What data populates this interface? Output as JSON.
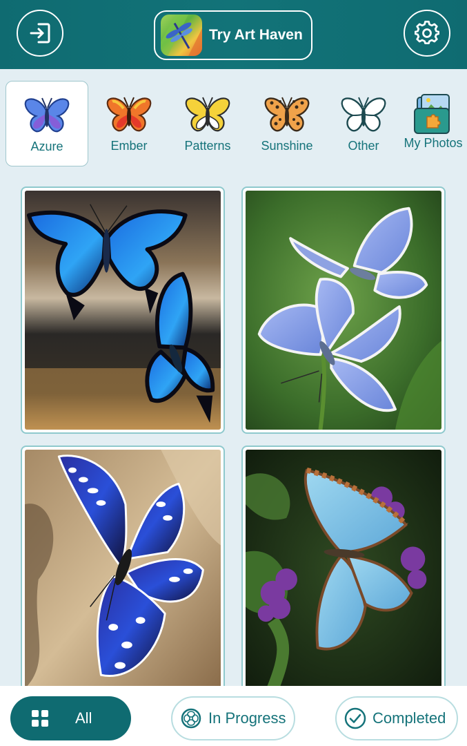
{
  "header": {
    "login_icon": "login-icon",
    "settings_icon": "gear-icon",
    "promo_label": "Try Art Haven"
  },
  "categories": [
    {
      "label": "Azure",
      "active": true,
      "icon": "blue-butterfly-icon"
    },
    {
      "label": "Ember",
      "active": false,
      "icon": "orange-butterfly-icon"
    },
    {
      "label": "Patterns",
      "active": false,
      "icon": "yellow-butterfly-icon"
    },
    {
      "label": "Sunshine",
      "active": false,
      "icon": "spotted-butterfly-icon"
    },
    {
      "label": "Other",
      "active": false,
      "icon": "outline-butterfly-icon"
    },
    {
      "label": "My Photos",
      "active": false,
      "icon": "photo-puzzle-icon"
    }
  ],
  "gallery": {
    "items": [
      {
        "subject": "blue-swallowtail-pair-artwork"
      },
      {
        "subject": "pale-blue-butterflies-artwork"
      },
      {
        "subject": "striped-blue-butterfly-on-wood-artwork"
      },
      {
        "subject": "light-blue-morpho-on-flowers-artwork"
      }
    ]
  },
  "filters": {
    "all_label": "All",
    "progress_label": "In Progress",
    "completed_label": "Completed",
    "selected": "All"
  },
  "colors": {
    "brand_teal": "#0f6b71",
    "accent_text": "#15737a",
    "background": "#e3eef3"
  }
}
